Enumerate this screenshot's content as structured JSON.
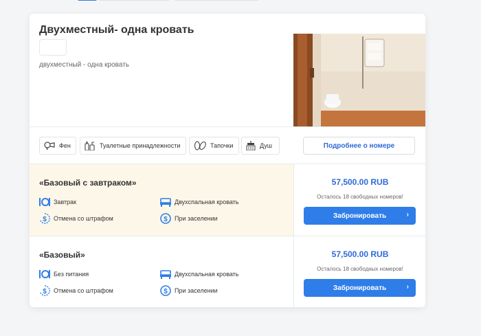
{
  "room": {
    "title": "Двухместный- одна кровать",
    "subtitle": "двухместный - одна кровать"
  },
  "amenities": [
    {
      "label": "Фен",
      "icon": "hairdryer-icon"
    },
    {
      "label": "Туалетные принадлежности",
      "icon": "toiletries-icon"
    },
    {
      "label": "Тапочки",
      "icon": "slippers-icon"
    },
    {
      "label": "Душ",
      "icon": "shower-icon"
    }
  ],
  "details_button": "Подробнее о номере",
  "rates": [
    {
      "name": "«Базовый с завтраком»",
      "features": [
        {
          "label": "Завтрак",
          "icon": "meal-icon"
        },
        {
          "label": "Двухспальная кровать",
          "icon": "bed-icon"
        },
        {
          "label": "Отмена со штрафом",
          "icon": "cancellation-fee-icon"
        },
        {
          "label": "При заселении",
          "icon": "payment-icon"
        }
      ],
      "price": "57,500.00 RUB",
      "availability": "Осталось 18 свободных номеров!",
      "book_label": "Забронировать"
    },
    {
      "name": "«Базовый»",
      "features": [
        {
          "label": "Без питания",
          "icon": "meal-icon"
        },
        {
          "label": "Двухспальная кровать",
          "icon": "bed-icon"
        },
        {
          "label": "Отмена со штрафом",
          "icon": "cancellation-fee-icon"
        },
        {
          "label": "При заселении",
          "icon": "payment-icon"
        }
      ],
      "price": "57,500.00 RUB",
      "availability": "Осталось 18 свободных номеров!",
      "book_label": "Забронировать"
    }
  ],
  "colors": {
    "accent": "#2f7de8",
    "price": "#2d6ad8",
    "highlight_row": "#fdf7e9"
  }
}
